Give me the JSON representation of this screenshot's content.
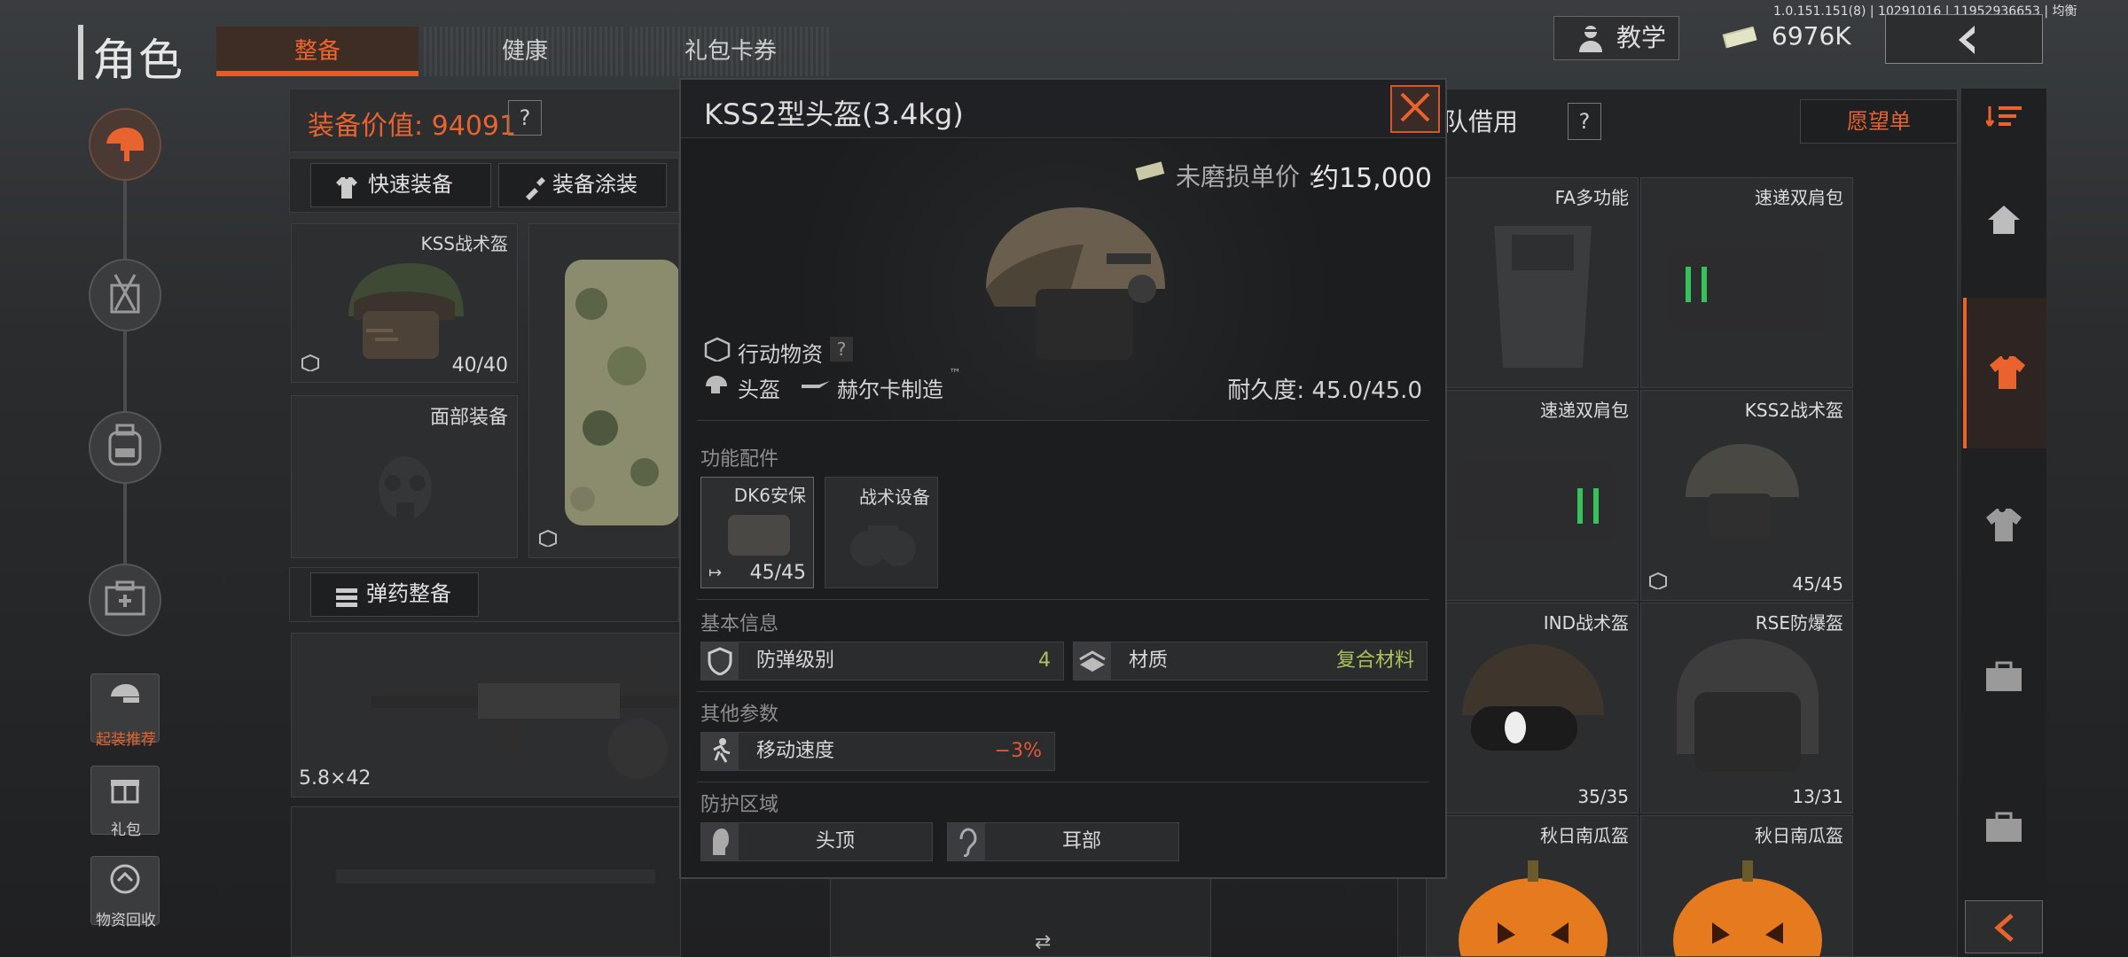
{
  "header": {
    "title": "角色",
    "tabs": [
      "整备",
      "健康",
      "礼包卡券"
    ],
    "active_tab": 0,
    "version": "1.0.151.151(8) | 10291016 | 11952936653 | 均衡",
    "teach_label": "教学",
    "money": "6976K"
  },
  "sidebar": {
    "items": [
      {
        "icon": "helmet-gun-icon"
      },
      {
        "icon": "backpack-icon"
      },
      {
        "icon": "bag-icon"
      },
      {
        "icon": "medkit-icon"
      }
    ],
    "buttons": [
      {
        "icon": "loadout-icon",
        "label": "起装推荐"
      },
      {
        "icon": "gift-icon",
        "label": "礼包"
      },
      {
        "icon": "recycle-icon",
        "label": "物资回收"
      }
    ]
  },
  "equipment": {
    "value_label": "装备价值: 94091",
    "help": "?",
    "quick_equip": "快速装备",
    "paint": "装备涂装",
    "helmet_name": "KSS战术盔",
    "helmet_durability": "40/40",
    "face_label": "面部装备",
    "ammo_label": "弹药整备",
    "gun_caliber": "5.8×42"
  },
  "right_panel": {
    "title": "团队借用",
    "help": "?",
    "wishlist": "愿望单",
    "items": [
      {
        "name": "FA多功能",
        "count": ""
      },
      {
        "name": "速递双肩包",
        "count": ""
      },
      {
        "name": "速递双肩包",
        "count": ""
      },
      {
        "name": "KSS2战术盔",
        "count": "45/45"
      },
      {
        "name": "IND战术盔",
        "count": "35/35"
      },
      {
        "name": "RSE防爆盔",
        "count": "13/31"
      },
      {
        "name": "秋日南瓜盔",
        "count": ""
      },
      {
        "name": "秋日南瓜盔",
        "count": ""
      }
    ]
  },
  "modal": {
    "title": "KSS2型头盔(3.4kg)",
    "price_label": "未磨损单价 :",
    "price_value": "约15,000",
    "category": "行动物资",
    "category_help": "?",
    "type": "头盔",
    "maker": "赫尔卡制造",
    "tm": "™",
    "durability": "耐久度: 45.0/45.0",
    "section_attachments": "功能配件",
    "att1_name": "DK6安保",
    "att1_count": "45/45",
    "att2_name": "战术设备",
    "section_basic": "基本信息",
    "armor_label": "防弹级别",
    "armor_value": "4",
    "material_label": "材质",
    "material_value": "复合材料",
    "section_other": "其他参数",
    "speed_label": "移动速度",
    "speed_value": "−3%",
    "section_protect": "防护区域",
    "zone1": "头顶",
    "zone2": "耳部"
  },
  "colors": {
    "accent": "#e35d28",
    "positive": "#a9c55a",
    "negative": "#e2573c"
  }
}
